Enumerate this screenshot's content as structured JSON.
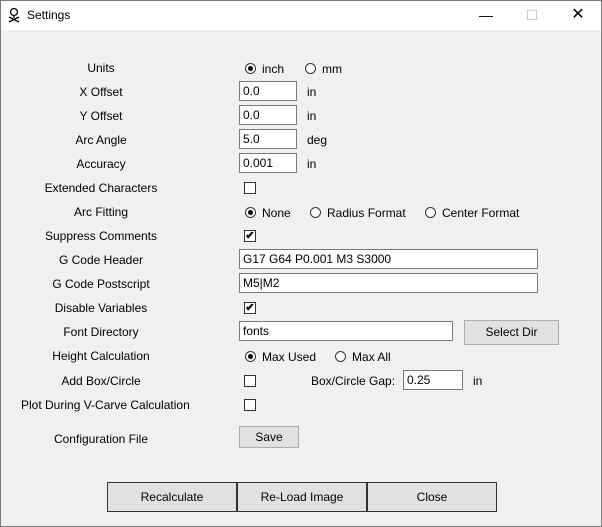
{
  "window": {
    "title": "Settings",
    "minimize": "—",
    "maximize": "☐",
    "close": "✕"
  },
  "units": {
    "label": "Units",
    "options": [
      "inch",
      "mm"
    ],
    "selected": "inch"
  },
  "x_offset": {
    "label": "X Offset",
    "value": "0.0",
    "unit": "in"
  },
  "y_offset": {
    "label": "Y Offset",
    "value": "0.0",
    "unit": "in"
  },
  "arc_angle": {
    "label": "Arc Angle",
    "value": "5.0",
    "unit": "deg"
  },
  "accuracy": {
    "label": "Accuracy",
    "value": "0.001",
    "unit": "in"
  },
  "extended_characters": {
    "label": "Extended Characters",
    "checked": false
  },
  "arc_fitting": {
    "label": "Arc Fitting",
    "options": [
      "None",
      "Radius Format",
      "Center Format"
    ],
    "selected": "None"
  },
  "suppress_comments": {
    "label": "Suppress Comments",
    "checked": true
  },
  "gcode_header": {
    "label": "G Code Header",
    "value": "G17 G64 P0.001 M3 S3000"
  },
  "gcode_postscript": {
    "label": "G Code Postscript",
    "value": "M5|M2"
  },
  "disable_variables": {
    "label": "Disable Variables",
    "checked": true
  },
  "font_directory": {
    "label": "Font Directory",
    "value": "fonts",
    "button": "Select Dir"
  },
  "height_calculation": {
    "label": "Height Calculation",
    "options": [
      "Max Used",
      "Max All"
    ],
    "selected": "Max Used"
  },
  "add_box_circle": {
    "label": "Add Box/Circle",
    "checked": false,
    "gap_label": "Box/Circle Gap:",
    "gap_value": "0.25",
    "gap_unit": "in"
  },
  "plot_vcarve": {
    "label": "Plot During V-Carve Calculation",
    "checked": false
  },
  "configuration_file": {
    "label": "Configuration File",
    "button": "Save"
  },
  "footer": {
    "recalculate": "Recalculate",
    "reload": "Re-Load Image",
    "close": "Close"
  },
  "check_mark": "✔"
}
